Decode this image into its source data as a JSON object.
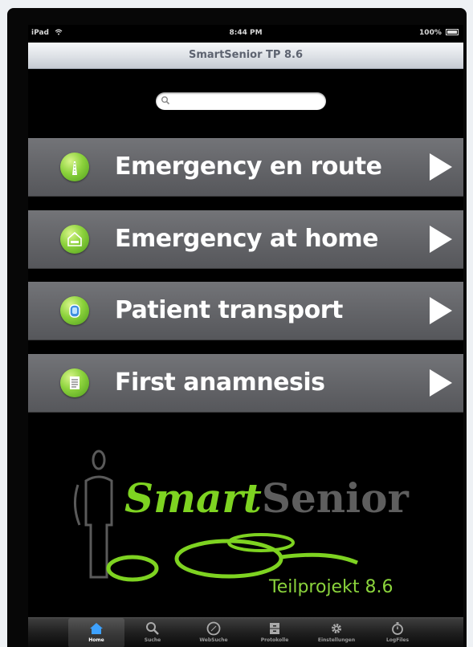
{
  "status": {
    "carrier": "iPad",
    "time": "8:44 PM",
    "battery": "100%"
  },
  "navbar": {
    "title": "SmartSenior TP 8.6"
  },
  "search": {
    "placeholder": ""
  },
  "menu": [
    {
      "label": "Emergency en route",
      "icon": "road-icon"
    },
    {
      "label": "Emergency at home",
      "icon": "house-bed-icon"
    },
    {
      "label": "Patient transport",
      "icon": "siren-icon"
    },
    {
      "label": "First anamnesis",
      "icon": "checklist-icon"
    }
  ],
  "logo": {
    "part1": "Smart",
    "part2": "Senior",
    "subtitle": "Teilprojekt 8.6"
  },
  "tabbar": [
    {
      "label": "Home",
      "icon": "house-icon",
      "active": true
    },
    {
      "label": "Suche",
      "icon": "search-icon"
    },
    {
      "label": "WebSuche",
      "icon": "compass-icon"
    },
    {
      "label": "Protokolle",
      "icon": "cabinet-icon"
    },
    {
      "label": "Einstellungen",
      "icon": "gear-icon"
    },
    {
      "label": "LogFiles",
      "icon": "stopwatch-icon"
    }
  ],
  "colors": {
    "accent_green": "#7ed321",
    "row_gray": "#646569",
    "logo_gray": "#5e5e5e"
  }
}
